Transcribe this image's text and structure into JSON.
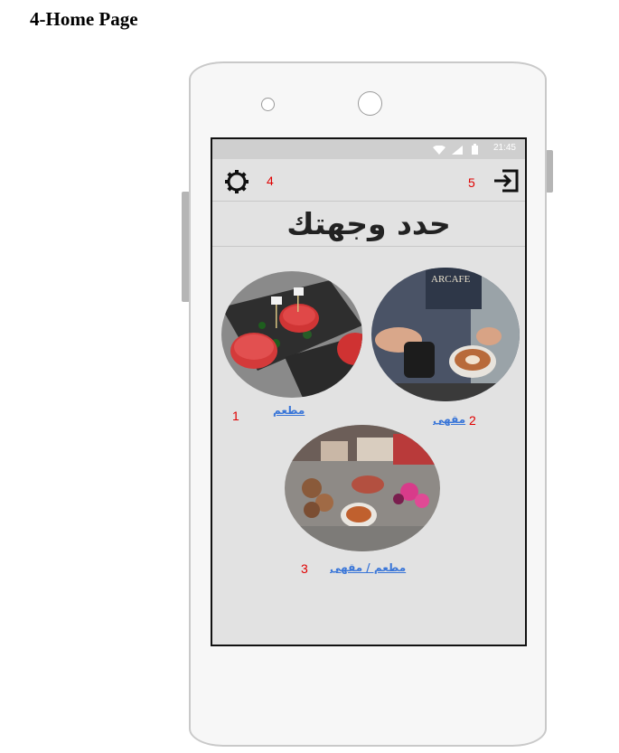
{
  "page_heading": "4-Home Page",
  "status_bar": {
    "time": "21:45"
  },
  "screen": {
    "title": "حدد وجهتك",
    "markers": {
      "settings": "4",
      "logout": "5",
      "restaurant": "1",
      "cafe": "2",
      "both": "3"
    },
    "options": {
      "restaurant": {
        "label": "مطعم"
      },
      "cafe": {
        "label": "مقهى"
      },
      "both": {
        "label": "مطعم / مقهى"
      }
    }
  },
  "colors": {
    "link": "#3a76d8",
    "marker": "#e00000",
    "screen_bg": "#e2e2e2"
  },
  "icons": [
    "settings-icon",
    "logout-icon",
    "wifi-icon",
    "signal-icon",
    "battery-icon"
  ]
}
